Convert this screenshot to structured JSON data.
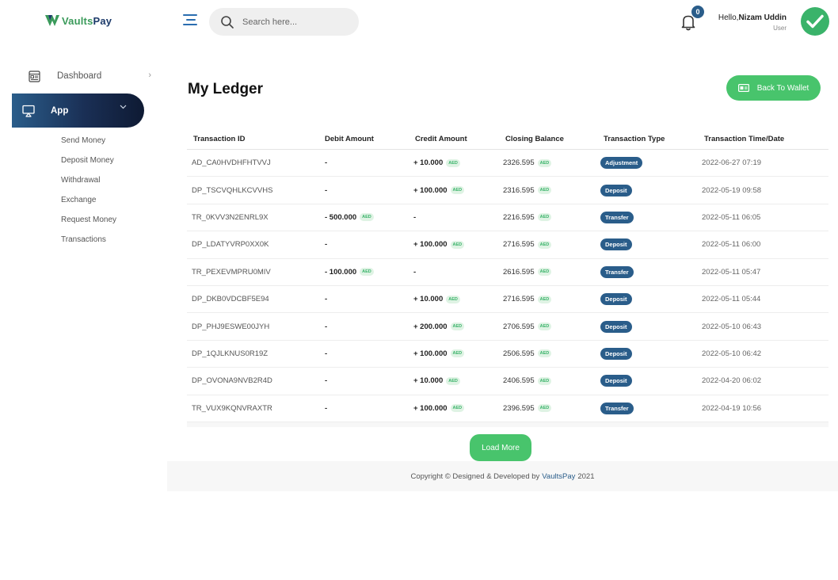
{
  "header": {
    "logo_text_a": "Vaults",
    "logo_text_b": "Pay",
    "search_placeholder": "Search here...",
    "notification_count": "0",
    "greeting": "Hello,",
    "user_name": "Nizam Uddin",
    "user_role": "User",
    "icons": [
      "menu-icon",
      "search-icon",
      "bell-icon",
      "check-icon"
    ]
  },
  "sidebar": {
    "dashboard_label": "Dashboard",
    "app_label": "App",
    "sub_items": [
      {
        "label": "Send Money"
      },
      {
        "label": "Deposit Money"
      },
      {
        "label": "Withdrawal"
      },
      {
        "label": "Exchange"
      },
      {
        "label": "Request Money"
      },
      {
        "label": "Transactions"
      }
    ]
  },
  "main": {
    "title": "My Ledger",
    "back_button_label": "Back To Wallet",
    "currency": "AED",
    "columns": [
      "Transaction ID",
      "Debit Amount",
      "Credit Amount",
      "Closing Balance",
      "Transaction Type",
      "Transaction Time/Date"
    ],
    "rows": [
      {
        "id": "AD_CA0HVDHFHTVVJ",
        "debit": "-",
        "credit": "+ 10.000",
        "balance": "2326.595",
        "type": "Adjustment",
        "datetime": "2022-06-27 07:19"
      },
      {
        "id": "DP_TSCVQHLKCVVHS",
        "debit": "-",
        "credit": "+ 100.000",
        "balance": "2316.595",
        "type": "Deposit",
        "datetime": "2022-05-19 09:58"
      },
      {
        "id": "TR_0KVV3N2ENRL9X",
        "debit": "- 500.000",
        "credit": "-",
        "balance": "2216.595",
        "type": "Transfer",
        "datetime": "2022-05-11 06:05"
      },
      {
        "id": "DP_LDATYVRP0XX0K",
        "debit": "-",
        "credit": "+ 100.000",
        "balance": "2716.595",
        "type": "Deposit",
        "datetime": "2022-05-11 06:00"
      },
      {
        "id": "TR_PEXEVMPRU0MIV",
        "debit": "- 100.000",
        "credit": "-",
        "balance": "2616.595",
        "type": "Transfer",
        "datetime": "2022-05-11 05:47"
      },
      {
        "id": "DP_DKB0VDCBF5E94",
        "debit": "-",
        "credit": "+ 10.000",
        "balance": "2716.595",
        "type": "Deposit",
        "datetime": "2022-05-11 05:44"
      },
      {
        "id": "DP_PHJ9ESWE00JYH",
        "debit": "-",
        "credit": "+ 200.000",
        "balance": "2706.595",
        "type": "Deposit",
        "datetime": "2022-05-10 06:43"
      },
      {
        "id": "DP_1QJLKNUS0R19Z",
        "debit": "-",
        "credit": "+ 100.000",
        "balance": "2506.595",
        "type": "Deposit",
        "datetime": "2022-05-10 06:42"
      },
      {
        "id": "DP_OVONA9NVB2R4D",
        "debit": "-",
        "credit": "+ 10.000",
        "balance": "2406.595",
        "type": "Deposit",
        "datetime": "2022-04-20 06:02"
      },
      {
        "id": "TR_VUX9KQNVRAXTR",
        "debit": "-",
        "credit": "+ 100.000",
        "balance": "2396.595",
        "type": "Transfer",
        "datetime": "2022-04-19 10:56"
      }
    ],
    "load_more_label": "Load More"
  },
  "footer": {
    "prefix": "Copyright © Designed & Developed by",
    "brand": "VaultsPay",
    "year": "2021"
  },
  "colors": {
    "accent_green": "#48c46c",
    "brand_blue": "#2a5d8a",
    "sidebar_active_dark": "#0e1a33"
  }
}
